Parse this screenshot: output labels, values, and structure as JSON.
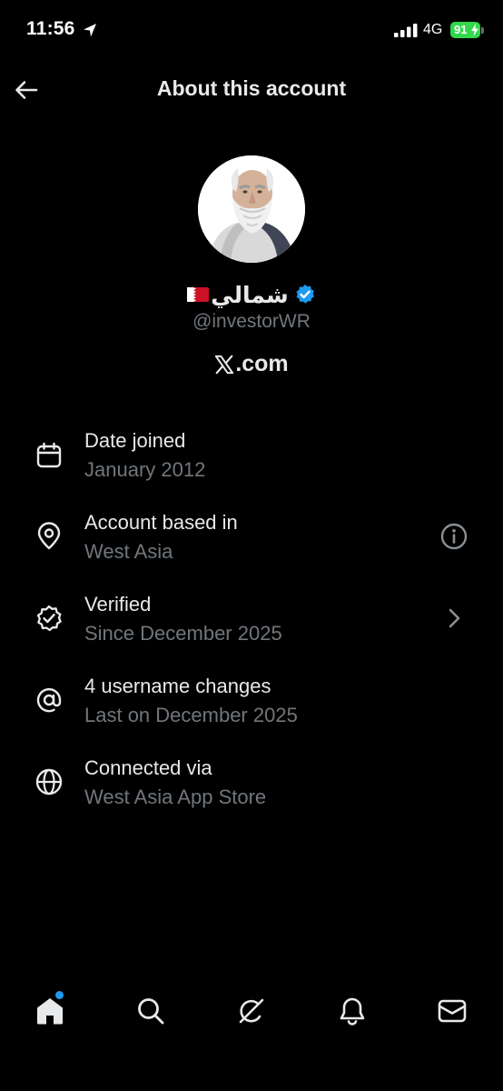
{
  "status_bar": {
    "time": "11:56",
    "network": "4G",
    "battery": "91"
  },
  "header": {
    "title": "About this account",
    "back_icon": "arrow-left-icon"
  },
  "profile": {
    "display_name": "شمالي",
    "flag": "bahrain-flag",
    "verified": true,
    "handle": "@investorWR",
    "site": ".com",
    "site_logo": "x-logo-icon"
  },
  "info": {
    "date_joined": {
      "icon": "calendar-icon",
      "title": "Date joined",
      "value": "January 2012"
    },
    "based_in": {
      "icon": "location-pin-icon",
      "title": "Account based in",
      "value": "West Asia",
      "trailing_icon": "info-icon"
    },
    "verified": {
      "icon": "verified-badge-outline-icon",
      "title": "Verified",
      "value": "Since December 2025",
      "trailing_icon": "chevron-right-icon"
    },
    "username_changes": {
      "icon": "at-sign-icon",
      "title": "4 username changes",
      "value": "Last on December 2025"
    },
    "connected_via": {
      "icon": "globe-icon",
      "title": "Connected via",
      "value": "West Asia App Store"
    }
  },
  "bottom_nav": {
    "items": [
      "home-icon",
      "search-icon",
      "grok-icon",
      "bell-icon",
      "mail-icon"
    ],
    "home_has_notification": true
  },
  "colors": {
    "background": "#000000",
    "primary_text": "#e7e9ea",
    "secondary_text": "#71767b",
    "accent": "#1d9bf0",
    "battery": "#32d74b"
  }
}
